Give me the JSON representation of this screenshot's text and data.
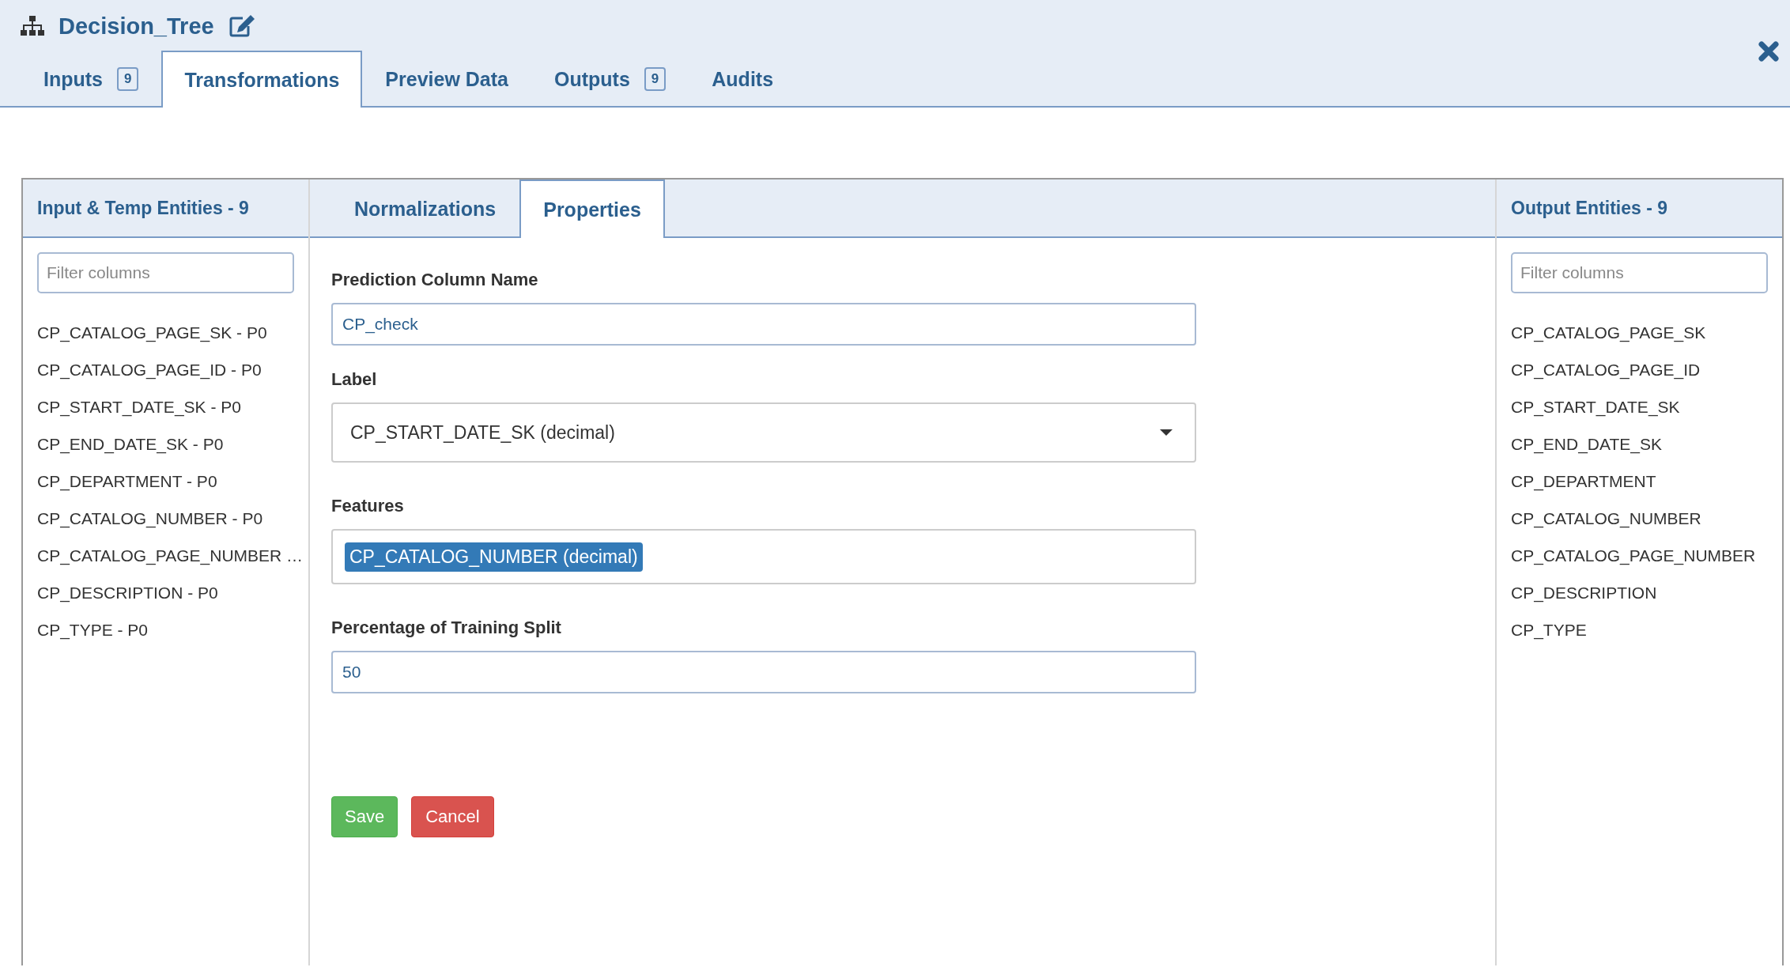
{
  "window": {
    "title": "Decision_Tree"
  },
  "tabs": [
    {
      "label": "Inputs",
      "badge": "9",
      "selected": false
    },
    {
      "label": "Transformations",
      "selected": true
    },
    {
      "label": "Preview Data",
      "selected": false
    },
    {
      "label": "Outputs",
      "badge": "9",
      "selected": false
    },
    {
      "label": "Audits",
      "selected": false
    }
  ],
  "left_panel": {
    "title": "Input & Temp Entities - 9",
    "filter": {
      "placeholder": "Filter columns"
    },
    "items": [
      "CP_CATALOG_PAGE_SK - P0",
      "CP_CATALOG_PAGE_ID - P0",
      "CP_START_DATE_SK - P0",
      "CP_END_DATE_SK - P0",
      "CP_DEPARTMENT - P0",
      "CP_CATALOG_NUMBER - P0",
      "CP_CATALOG_PAGE_NUMBER …",
      "CP_DESCRIPTION - P0",
      "CP_TYPE - P0"
    ]
  },
  "center_tabs": [
    {
      "label": "Normalizations",
      "selected": false
    },
    {
      "label": "Properties",
      "selected": true
    }
  ],
  "form": [
    {
      "kind": "text",
      "label": "Prediction Column Name",
      "value": "CP_check"
    },
    {
      "kind": "select",
      "label": "Label",
      "value": "CP_START_DATE_SK (decimal)"
    },
    {
      "kind": "tags",
      "label": "Features",
      "tags": [
        "CP_CATALOG_NUMBER (decimal)"
      ]
    },
    {
      "kind": "text",
      "label": "Percentage of Training Split",
      "value": "50"
    }
  ],
  "buttons": [
    {
      "label": "Save",
      "kind": "primary"
    },
    {
      "label": "Cancel",
      "kind": "danger"
    }
  ],
  "right_panel": {
    "title": "Output Entities  - 9",
    "filter": {
      "placeholder": "Filter columns"
    },
    "items": [
      "CP_CATALOG_PAGE_SK",
      "CP_CATALOG_PAGE_ID",
      "CP_START_DATE_SK",
      "CP_END_DATE_SK",
      "CP_DEPARTMENT",
      "CP_CATALOG_NUMBER",
      "CP_CATALOG_PAGE_NUMBER",
      "CP_DESCRIPTION",
      "CP_TYPE"
    ]
  }
}
